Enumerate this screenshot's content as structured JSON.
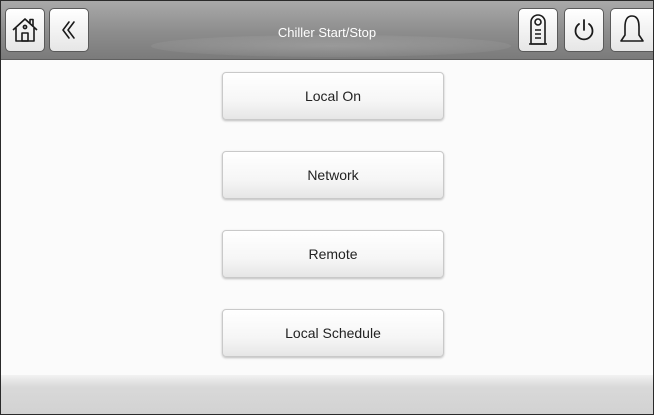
{
  "header": {
    "title": "Chiller Start/Stop",
    "home_icon": "home-icon",
    "back_icon": "double-chevron-left-icon",
    "lock_icon": "door-hanger-lock-icon",
    "power_icon": "power-icon",
    "alarm_icon": "bell-icon"
  },
  "menu": {
    "items": [
      {
        "label": "Local On"
      },
      {
        "label": "Network"
      },
      {
        "label": "Remote"
      },
      {
        "label": "Local Schedule"
      }
    ]
  },
  "colors": {
    "header_bg": "#8c8c8c",
    "header_text": "#ffffff",
    "body_bg": "#fbfbfb",
    "button_text": "#222222"
  }
}
